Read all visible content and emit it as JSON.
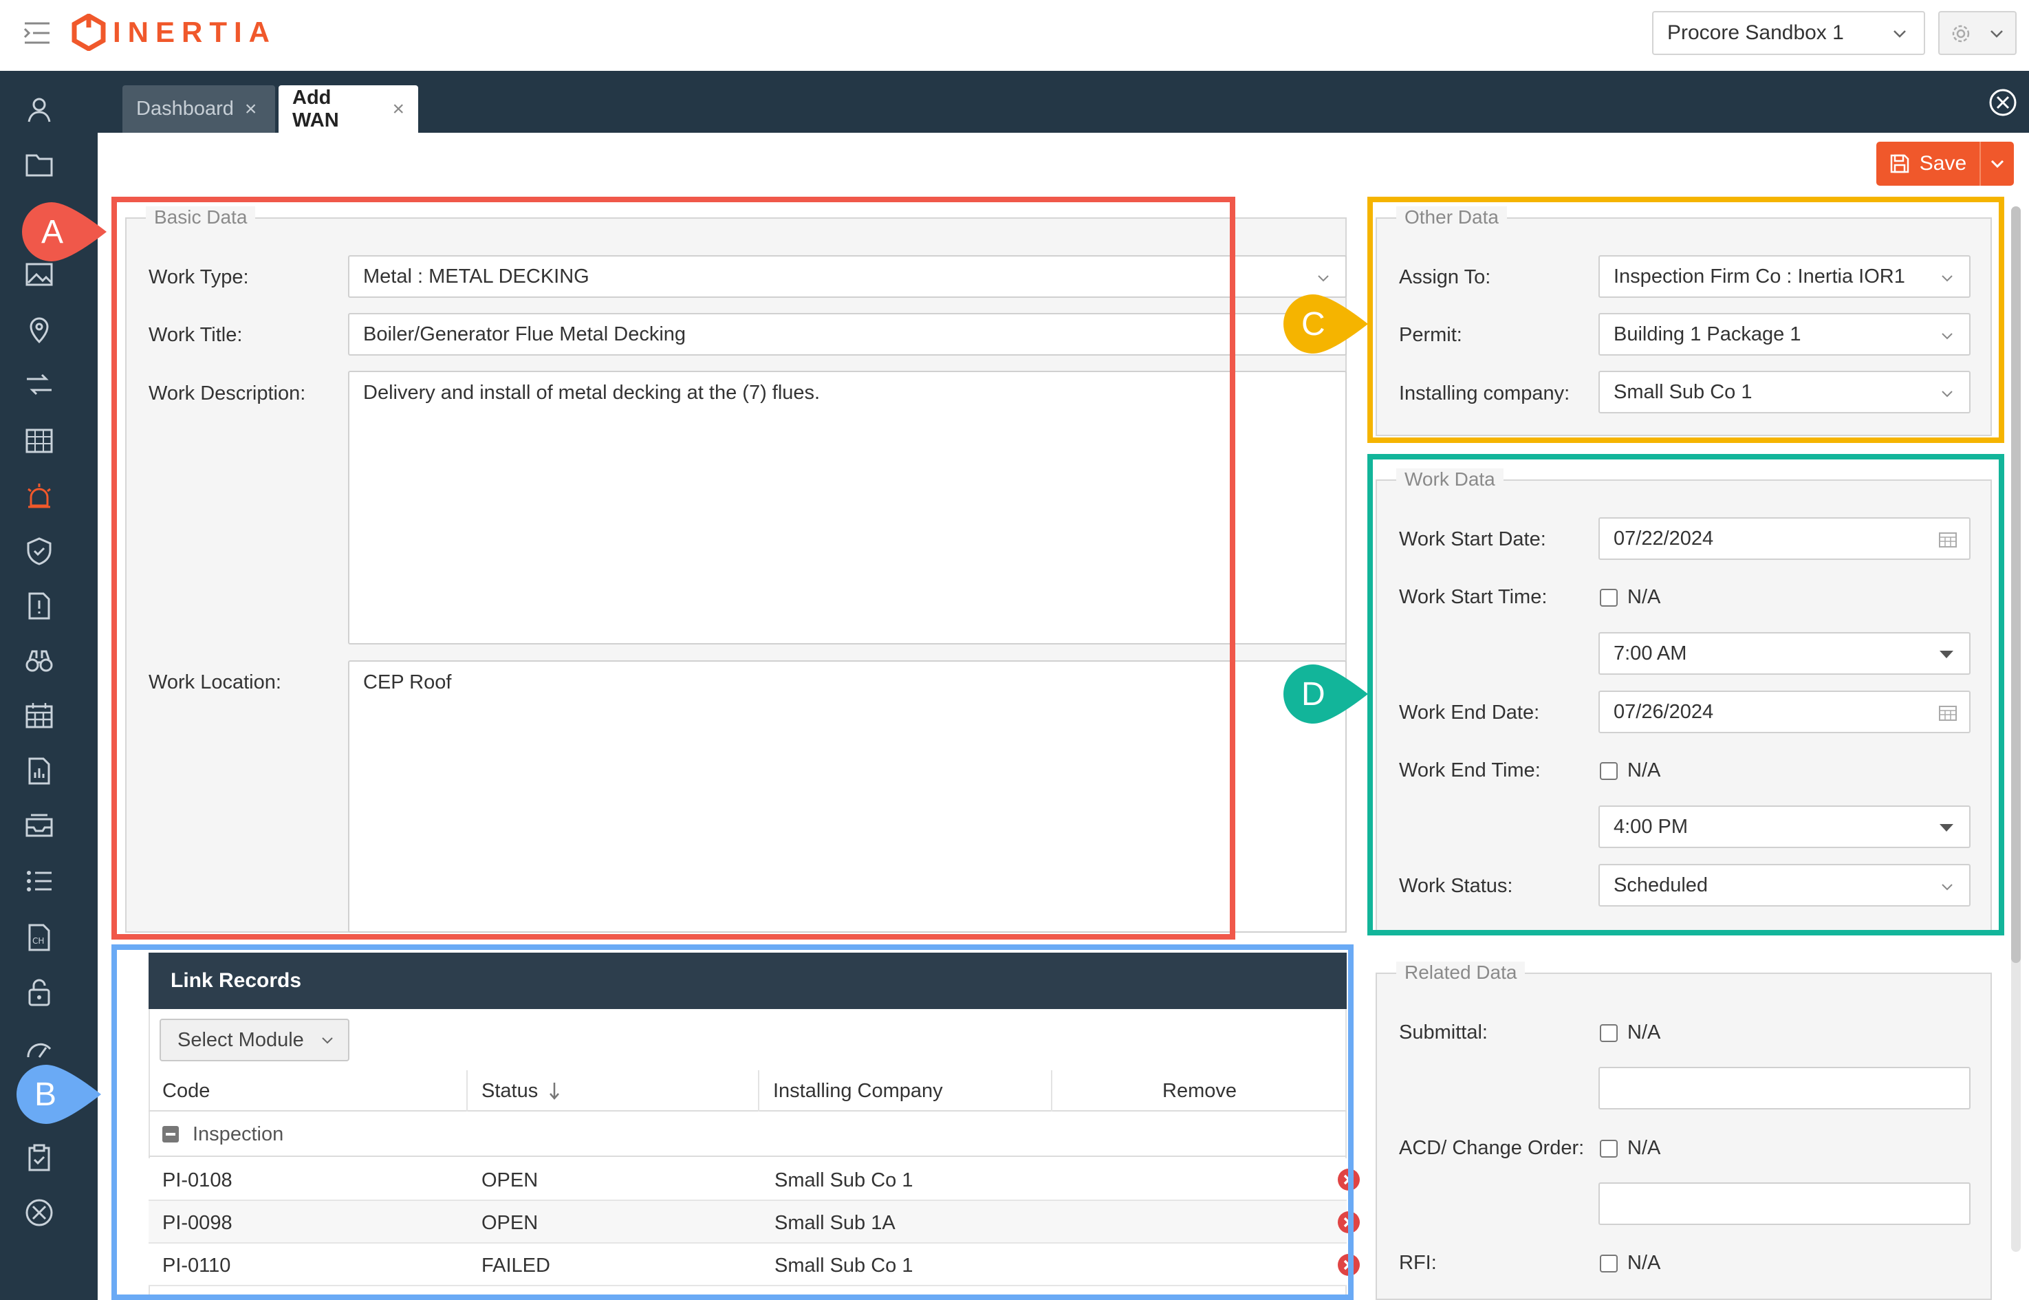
{
  "app": {
    "logo_text": "INERTIA",
    "brand_color": "#f0582b"
  },
  "header": {
    "project": "Procore Sandbox 1"
  },
  "tabs": [
    {
      "label": "Dashboard",
      "active": false
    },
    {
      "label": "Add WAN",
      "active": true
    }
  ],
  "sidenav": {
    "icons": [
      "user-icon",
      "folder-icon",
      "image-icon",
      "location-pin-icon",
      "transfer-icon",
      "calendar-grid-icon",
      "alarm-icon",
      "shield-check-icon",
      "report-alert-icon",
      "binoculars-icon",
      "schedule-icon",
      "chart-document-icon",
      "inbox-icon",
      "list-icon",
      "change-order-icon",
      "lock-icon",
      "gauge-icon",
      "clipboard-check-icon",
      "tools-icon"
    ],
    "active_icon": "alarm-icon"
  },
  "toolbar": {
    "save_label": "Save"
  },
  "basic_data": {
    "legend": "Basic Data",
    "work_type_label": "Work Type:",
    "work_type_value": "Metal : METAL DECKING",
    "work_title_label": "Work Title:",
    "work_title_value": "Boiler/Generator Flue Metal Decking",
    "work_description_label": "Work Description:",
    "work_description_value": "Delivery and install of metal decking at the (7) flues.",
    "work_location_label": "Work Location:",
    "work_location_value": "CEP Roof"
  },
  "other_data": {
    "legend": "Other Data",
    "assign_to_label": "Assign To:",
    "assign_to_value": "Inspection Firm Co : Inertia IOR1",
    "permit_label": "Permit:",
    "permit_value": "Building 1 Package 1",
    "installing_company_label": "Installing company:",
    "installing_company_value": "Small Sub Co 1"
  },
  "work_data": {
    "legend": "Work Data",
    "start_date_label": "Work Start Date:",
    "start_date_value": "07/22/2024",
    "start_time_label": "Work Start Time:",
    "start_time_na": "N/A",
    "start_time_value": "7:00 AM",
    "end_date_label": "Work End Date:",
    "end_date_value": "07/26/2024",
    "end_time_label": "Work End Time:",
    "end_time_na": "N/A",
    "end_time_value": "4:00 PM",
    "status_label": "Work Status:",
    "status_value": "Scheduled"
  },
  "related_data": {
    "legend": "Related Data",
    "submittal_label": "Submittal:",
    "submittal_na": "N/A",
    "acd_label": "ACD/ Change Order:",
    "acd_na": "N/A",
    "rfi_label": "RFI:",
    "rfi_na": "N/A"
  },
  "link_records": {
    "title": "Link Records",
    "select_module": "Select Module",
    "columns": [
      "Code",
      "Status",
      "Installing Company",
      "Remove"
    ],
    "group": "Inspection",
    "rows": [
      {
        "code": "PI-0108",
        "status": "OPEN",
        "company": "Small Sub Co 1"
      },
      {
        "code": "PI-0098",
        "status": "OPEN",
        "company": "Small Sub 1A"
      },
      {
        "code": "PI-0110",
        "status": "FAILED",
        "company": "Small Sub Co 1"
      }
    ]
  },
  "annotations": [
    {
      "letter": "A",
      "color": "#f0584a"
    },
    {
      "letter": "B",
      "color": "#6aaaf5"
    },
    {
      "letter": "C",
      "color": "#f5b400"
    },
    {
      "letter": "D",
      "color": "#12b59a"
    }
  ]
}
